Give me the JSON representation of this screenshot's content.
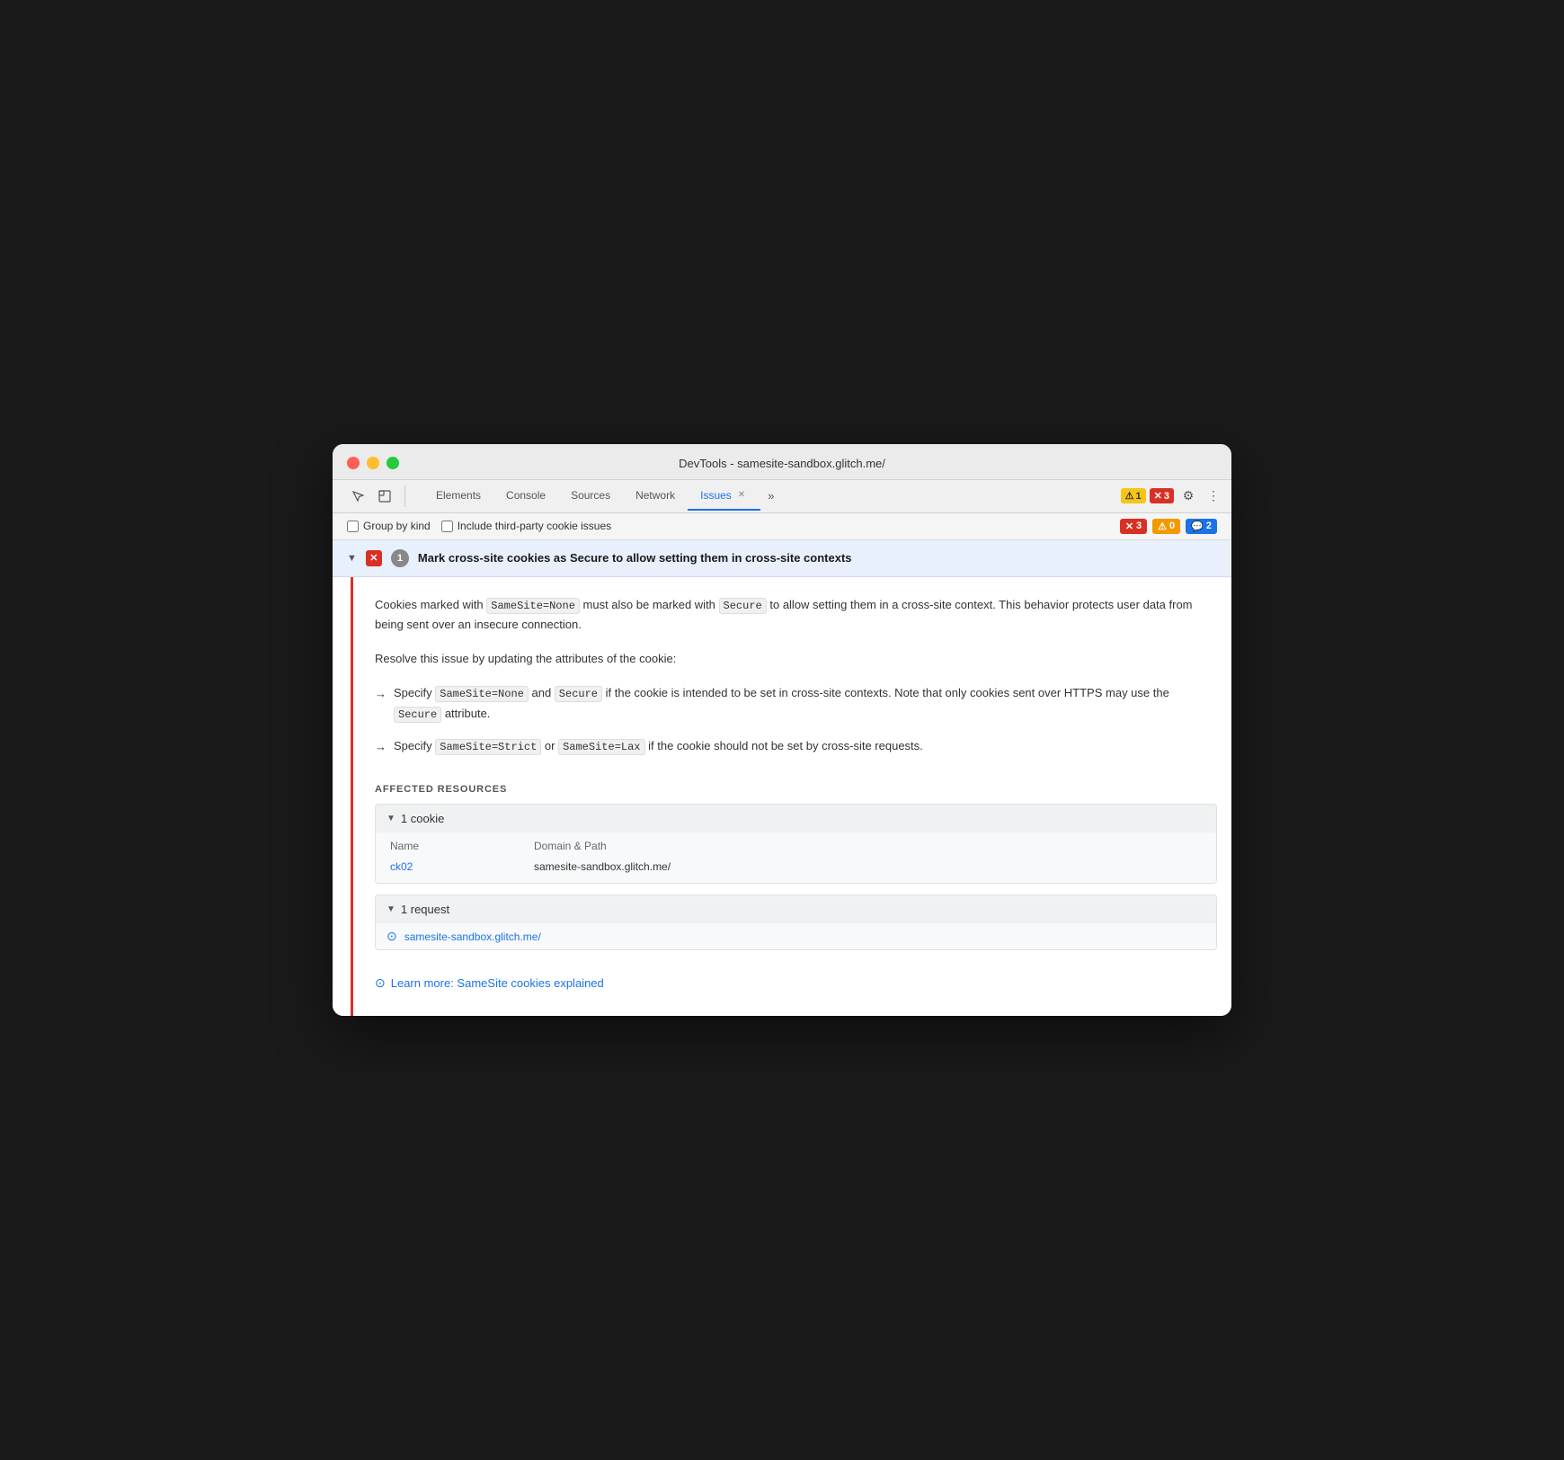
{
  "window": {
    "title": "DevTools - samesite-sandbox.glitch.me/"
  },
  "tabs": [
    {
      "label": "Elements",
      "active": false
    },
    {
      "label": "Console",
      "active": false
    },
    {
      "label": "Sources",
      "active": false
    },
    {
      "label": "Network",
      "active": false
    },
    {
      "label": "Issues",
      "active": true,
      "closeable": true
    }
  ],
  "tab_overflow_label": "»",
  "tab_actions": {
    "warning_badge": "1",
    "error_badge": "3"
  },
  "toolbar": {
    "group_by_kind_label": "Group by kind",
    "third_party_label": "Include third-party cookie issues",
    "badges": {
      "error_count": "3",
      "warning_count": "0",
      "info_count": "2"
    }
  },
  "issue": {
    "count": "1",
    "title": "Mark cross-site cookies as Secure to allow setting them in cross-site contexts",
    "description_parts": [
      "Cookies marked with SameSite=None must also be marked with Secure to allow setting them in a cross-site context. This behavior protects user data from being sent over an insecure connection.",
      "Resolve this issue by updating the attributes of the cookie:"
    ],
    "bullets": [
      {
        "arrow": "→",
        "text_before": "Specify",
        "code1": "SameSite=None",
        "text_between": "and",
        "code2": "Secure",
        "text_after": "if the cookie is intended to be set in cross-site contexts. Note that only cookies sent over HTTPS may use the",
        "code3": "Secure",
        "text_end": "attribute."
      },
      {
        "arrow": "→",
        "text_before": "Specify",
        "code1": "SameSite=Strict",
        "text_between": "or",
        "code2": "SameSite=Lax",
        "text_after": "if the cookie should not be set by cross-site requests."
      }
    ],
    "affected_resources_label": "AFFECTED RESOURCES",
    "cookie_group": {
      "toggle": "▼",
      "label": "1 cookie",
      "table": {
        "col_name": "Name",
        "col_domain": "Domain & Path",
        "rows": [
          {
            "name": "ck02",
            "domain": "samesite-sandbox.glitch.me/"
          }
        ]
      }
    },
    "request_group": {
      "toggle": "▼",
      "label": "1 request",
      "items": [
        {
          "url": "samesite-sandbox.glitch.me/"
        }
      ]
    },
    "learn_more": {
      "label": "Learn more: SameSite cookies explained",
      "icon": "⊙"
    }
  },
  "icons": {
    "cursor": "⬆",
    "inspect": "⬜",
    "gear": "⚙",
    "more": "⋮",
    "warning_icon": "⚠",
    "error_icon": "✕",
    "toggle_down": "▼",
    "toggle_right": "▶"
  }
}
